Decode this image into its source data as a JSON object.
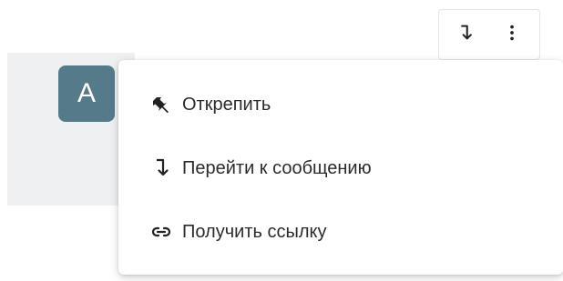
{
  "message": {
    "avatar_letter": "A",
    "avatar_color": "#557a8a"
  },
  "toolbar": {
    "buttons": [
      {
        "icon": "jump-to-message-icon"
      },
      {
        "icon": "more-vertical-icon"
      }
    ]
  },
  "menu": {
    "items": [
      {
        "label": "Открепить",
        "icon": "pin-off-icon"
      },
      {
        "label": "Перейти к сообщению",
        "icon": "jump-to-message-icon"
      },
      {
        "label": "Получить ссылку",
        "icon": "link-icon"
      }
    ]
  }
}
